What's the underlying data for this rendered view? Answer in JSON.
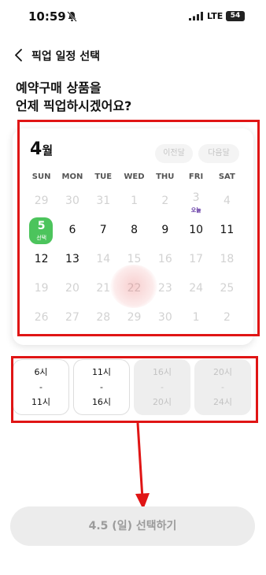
{
  "status_bar": {
    "time": "10:59",
    "network": "LTE",
    "battery": "54"
  },
  "header": {
    "title": "픽업 일정 선택"
  },
  "question": {
    "line1": "예약구매 상품을",
    "line2": "언제 픽업하시겠어요?"
  },
  "calendar": {
    "month_num": "4",
    "month_suffix": "월",
    "prev_label": "이전달",
    "next_label": "다음달",
    "weekdays": [
      "SUN",
      "MON",
      "TUE",
      "WED",
      "THU",
      "FRI",
      "SAT"
    ],
    "days": [
      {
        "label": "29",
        "state": "disabled"
      },
      {
        "label": "30",
        "state": "disabled"
      },
      {
        "label": "31",
        "state": "disabled"
      },
      {
        "label": "1",
        "state": "disabled"
      },
      {
        "label": "2",
        "state": "disabled"
      },
      {
        "label": "3",
        "state": "today",
        "tag": "오늘"
      },
      {
        "label": "4",
        "state": "disabled"
      },
      {
        "label": "5",
        "state": "selected",
        "tag": "선택"
      },
      {
        "label": "6",
        "state": "available"
      },
      {
        "label": "7",
        "state": "available"
      },
      {
        "label": "8",
        "state": "available"
      },
      {
        "label": "9",
        "state": "available"
      },
      {
        "label": "10",
        "state": "available"
      },
      {
        "label": "11",
        "state": "available"
      },
      {
        "label": "12",
        "state": "available"
      },
      {
        "label": "13",
        "state": "available"
      },
      {
        "label": "14",
        "state": "disabled"
      },
      {
        "label": "15",
        "state": "disabled"
      },
      {
        "label": "16",
        "state": "disabled"
      },
      {
        "label": "17",
        "state": "disabled"
      },
      {
        "label": "18",
        "state": "disabled"
      },
      {
        "label": "19",
        "state": "disabled"
      },
      {
        "label": "20",
        "state": "disabled"
      },
      {
        "label": "21",
        "state": "disabled"
      },
      {
        "label": "22",
        "state": "disabled"
      },
      {
        "label": "23",
        "state": "disabled"
      },
      {
        "label": "24",
        "state": "disabled"
      },
      {
        "label": "25",
        "state": "disabled"
      },
      {
        "label": "26",
        "state": "disabled"
      },
      {
        "label": "27",
        "state": "disabled"
      },
      {
        "label": "28",
        "state": "disabled"
      },
      {
        "label": "29",
        "state": "disabled"
      },
      {
        "label": "30",
        "state": "disabled"
      },
      {
        "label": "1",
        "state": "disabled"
      },
      {
        "label": "2",
        "state": "disabled"
      }
    ]
  },
  "time_slots": [
    {
      "start": "6시",
      "dash": "-",
      "end": "11시",
      "enabled": true
    },
    {
      "start": "11시",
      "dash": "-",
      "end": "16시",
      "enabled": true
    },
    {
      "start": "16시",
      "dash": "-",
      "end": "20시",
      "enabled": false
    },
    {
      "start": "20시",
      "dash": "-",
      "end": "24시",
      "enabled": false
    }
  ],
  "select_button": {
    "label": "4.5 (일) 선택하기"
  },
  "colors": {
    "accent": "#4cc45c",
    "annotation": "#e01515",
    "today": "#5a2d9f"
  }
}
